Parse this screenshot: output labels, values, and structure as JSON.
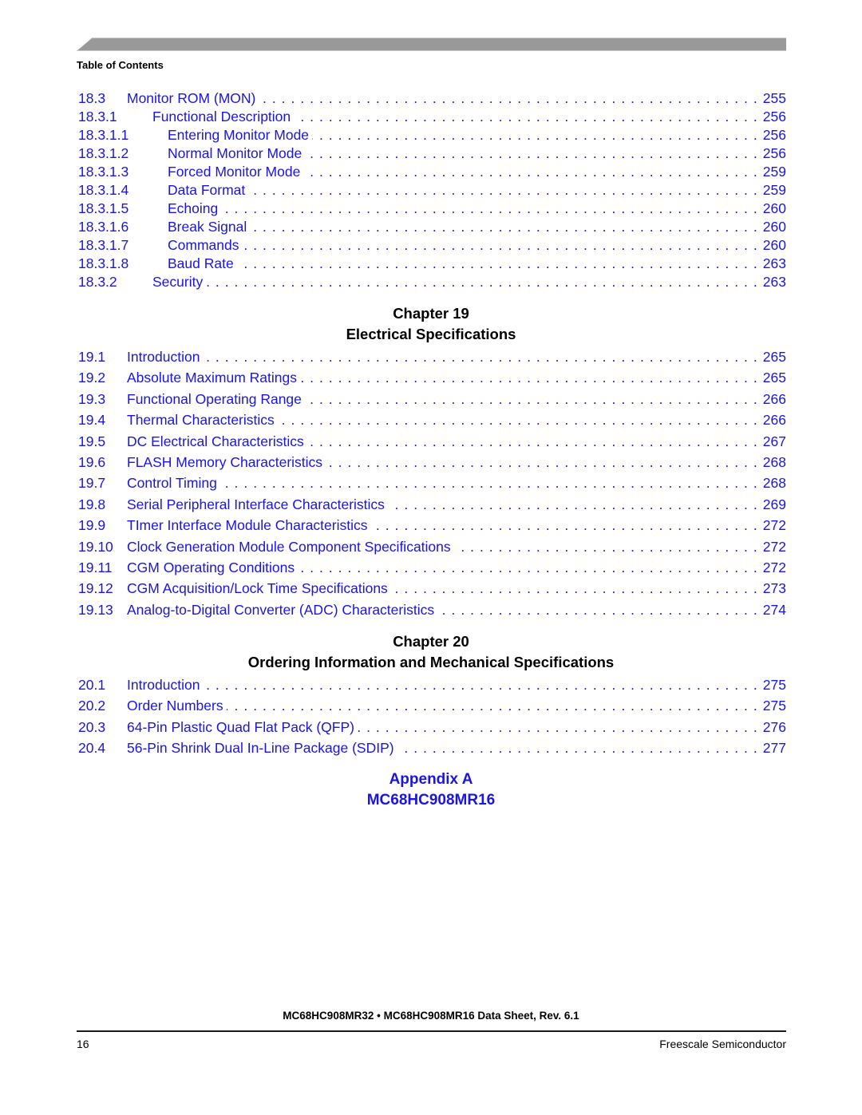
{
  "header": {
    "running_head": "Table of Contents",
    "bar_color": "#999999"
  },
  "link_color": "#1a14e6",
  "section18": {
    "entries": [
      {
        "number": "18.3",
        "title": "Monitor ROM (MON)",
        "page": "255",
        "level": 1
      },
      {
        "number": "18.3.1",
        "title": "Functional Description",
        "page": "256",
        "level": 2
      },
      {
        "number": "18.3.1.1",
        "title": "Entering Monitor Mode",
        "page": "256",
        "level": 3
      },
      {
        "number": "18.3.1.2",
        "title": "Normal Monitor Mode",
        "page": "256",
        "level": 3
      },
      {
        "number": "18.3.1.3",
        "title": "Forced Monitor Mode",
        "page": "259",
        "level": 3
      },
      {
        "number": "18.3.1.4",
        "title": "Data Format",
        "page": "259",
        "level": 3
      },
      {
        "number": "18.3.1.5",
        "title": "Echoing",
        "page": "260",
        "level": 3
      },
      {
        "number": "18.3.1.6",
        "title": "Break Signal",
        "page": "260",
        "level": 3
      },
      {
        "number": "18.3.1.7",
        "title": "Commands",
        "page": "260",
        "level": 3
      },
      {
        "number": "18.3.1.8",
        "title": "Baud Rate",
        "page": "263",
        "level": 3
      },
      {
        "number": "18.3.2",
        "title": "Security",
        "page": "263",
        "level": 2
      }
    ]
  },
  "chapter19": {
    "label": "Chapter 19",
    "title": "Electrical Specifications",
    "entries": [
      {
        "number": "19.1",
        "title": "Introduction",
        "page": "265"
      },
      {
        "number": "19.2",
        "title": "Absolute Maximum Ratings",
        "page": "265"
      },
      {
        "number": "19.3",
        "title": "Functional Operating Range",
        "page": "266"
      },
      {
        "number": "19.4",
        "title": "Thermal Characteristics",
        "page": "266"
      },
      {
        "number": "19.5",
        "title": "DC Electrical Characteristics",
        "page": "267"
      },
      {
        "number": "19.6",
        "title": "FLASH Memory Characteristics",
        "page": "268"
      },
      {
        "number": "19.7",
        "title": "Control Timing",
        "page": "268"
      },
      {
        "number": "19.8",
        "title": "Serial Peripheral Interface Characteristics",
        "page": "269"
      },
      {
        "number": "19.9",
        "title": "TImer Interface Module Characteristics",
        "page": "272"
      },
      {
        "number": "19.10",
        "title": "Clock Generation Module Component Specifications",
        "page": "272"
      },
      {
        "number": "19.11",
        "title": "CGM Operating Conditions",
        "page": "272"
      },
      {
        "number": "19.12",
        "title": "CGM Acquisition/Lock Time Specifications",
        "page": "273"
      },
      {
        "number": "19.13",
        "title": "Analog-to-Digital Converter (ADC) Characteristics",
        "page": "274"
      }
    ]
  },
  "chapter20": {
    "label": "Chapter 20",
    "title": "Ordering Information and Mechanical Specifications",
    "entries": [
      {
        "number": "20.1",
        "title": "Introduction",
        "page": "275"
      },
      {
        "number": "20.2",
        "title": "Order Numbers",
        "page": "275"
      },
      {
        "number": "20.3",
        "title": "64-Pin Plastic Quad Flat Pack (QFP)",
        "page": "276"
      },
      {
        "number": "20.4",
        "title": "56-Pin Shrink Dual In-Line Package (SDIP)",
        "page": "277"
      }
    ]
  },
  "appendixA": {
    "label": "Appendix A",
    "title": "MC68HC908MR16"
  },
  "footer": {
    "document_title": "MC68HC908MR32 • MC68HC908MR16 Data Sheet, Rev. 6.1",
    "page_number": "16",
    "company": "Freescale Semiconductor"
  }
}
